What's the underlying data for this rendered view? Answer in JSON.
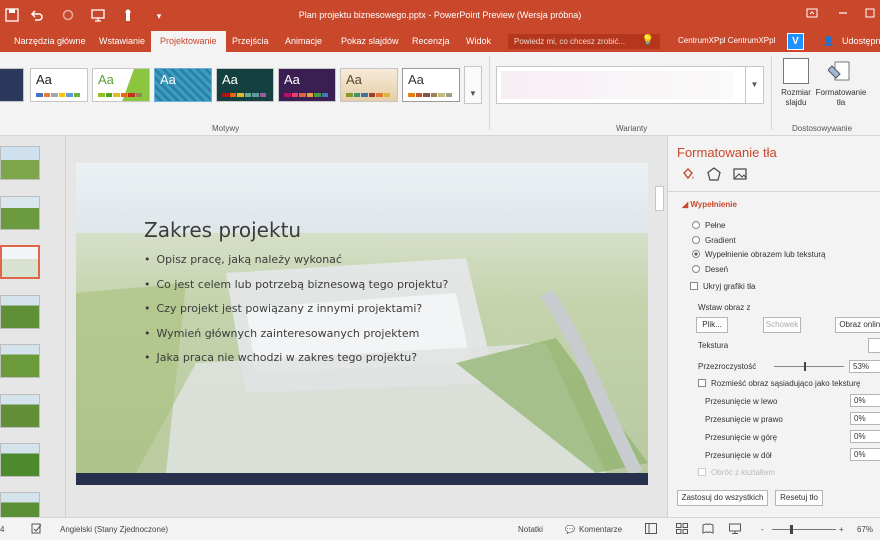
{
  "titlebar": {
    "title": "Plan projektu biznesowego.pptx - PowerPoint Preview (Wersja próbna)",
    "quick_access": [
      "save-icon",
      "undo-icon",
      "redo-icon",
      "present-icon",
      "touch-mode-icon",
      "customize-icon"
    ]
  },
  "tabs": [
    "Narzędzia główne",
    "Wstawianie",
    "Projektowanie",
    "Przejścia",
    "Animacje",
    "Pokaz slajdów",
    "Recenzja",
    "Widok"
  ],
  "active_tab": "Projektowanie",
  "tellme": {
    "placeholder": "Powiedz mi, co chcesz zrobić..."
  },
  "user": {
    "name": "CentrumXPpl CentrumXPpl",
    "avatar_letter": "V",
    "share": "Udostępnij"
  },
  "ribbon": {
    "themes_label": "Motywy",
    "variants_label": "Warianty",
    "customize_label": "Dostosowywanie",
    "theme_sample": "Aa",
    "slide_size_label": "Rozmiar slajdu",
    "format_bg_label": "Formatowanie tła"
  },
  "slide": {
    "title": "Zakres projektu",
    "bullets": [
      "Opisz pracę, jaką należy wykonać",
      "Co jest celem lub potrzebą biznesową tego projektu?",
      "Czy projekt jest powiązany z innymi projektami?",
      "Wymień głównych zainteresowanych projektem",
      "Jaka praca nie wchodzi w zakres tego projektu?"
    ]
  },
  "pane": {
    "title": "Formatowanie tła",
    "section": "Wypełnienie",
    "fill_options": [
      "Pełne",
      "Gradient",
      "Wypełnienie obrazem lub teksturą",
      "Deseń"
    ],
    "selected_fill": "Wypełnienie obrazem lub teksturą",
    "hide_graphics": "Ukryj grafiki tła",
    "insert_picture": "Wstaw obraz z",
    "file_btn": "Plik...",
    "clipboard_btn": "Schowek",
    "online_btn": "Obraz online",
    "texture": "Tekstura",
    "transparency": "Przezroczystość",
    "transparency_value": "53%",
    "tile": "Rozmieść obraz sąsiadująco jako teksturę",
    "offsets": [
      {
        "label": "Przesunięcie w lewo",
        "value": "0%"
      },
      {
        "label": "Przesunięcie w prawo",
        "value": "0%"
      },
      {
        "label": "Przesunięcie w górę",
        "value": "0%"
      },
      {
        "label": "Przesunięcie w dół",
        "value": "0%"
      }
    ],
    "rotate": "Obróć z kształtem",
    "apply_all": "Zastosuj do wszystkich",
    "reset": "Resetuj tło"
  },
  "statusbar": {
    "slide_num": "4",
    "language": "Angielski (Stany Zjednoczone)",
    "notes": "Notatki",
    "comments": "Komentarze",
    "zoom": "67%",
    "zoom_out": "-",
    "zoom_in": "+"
  }
}
